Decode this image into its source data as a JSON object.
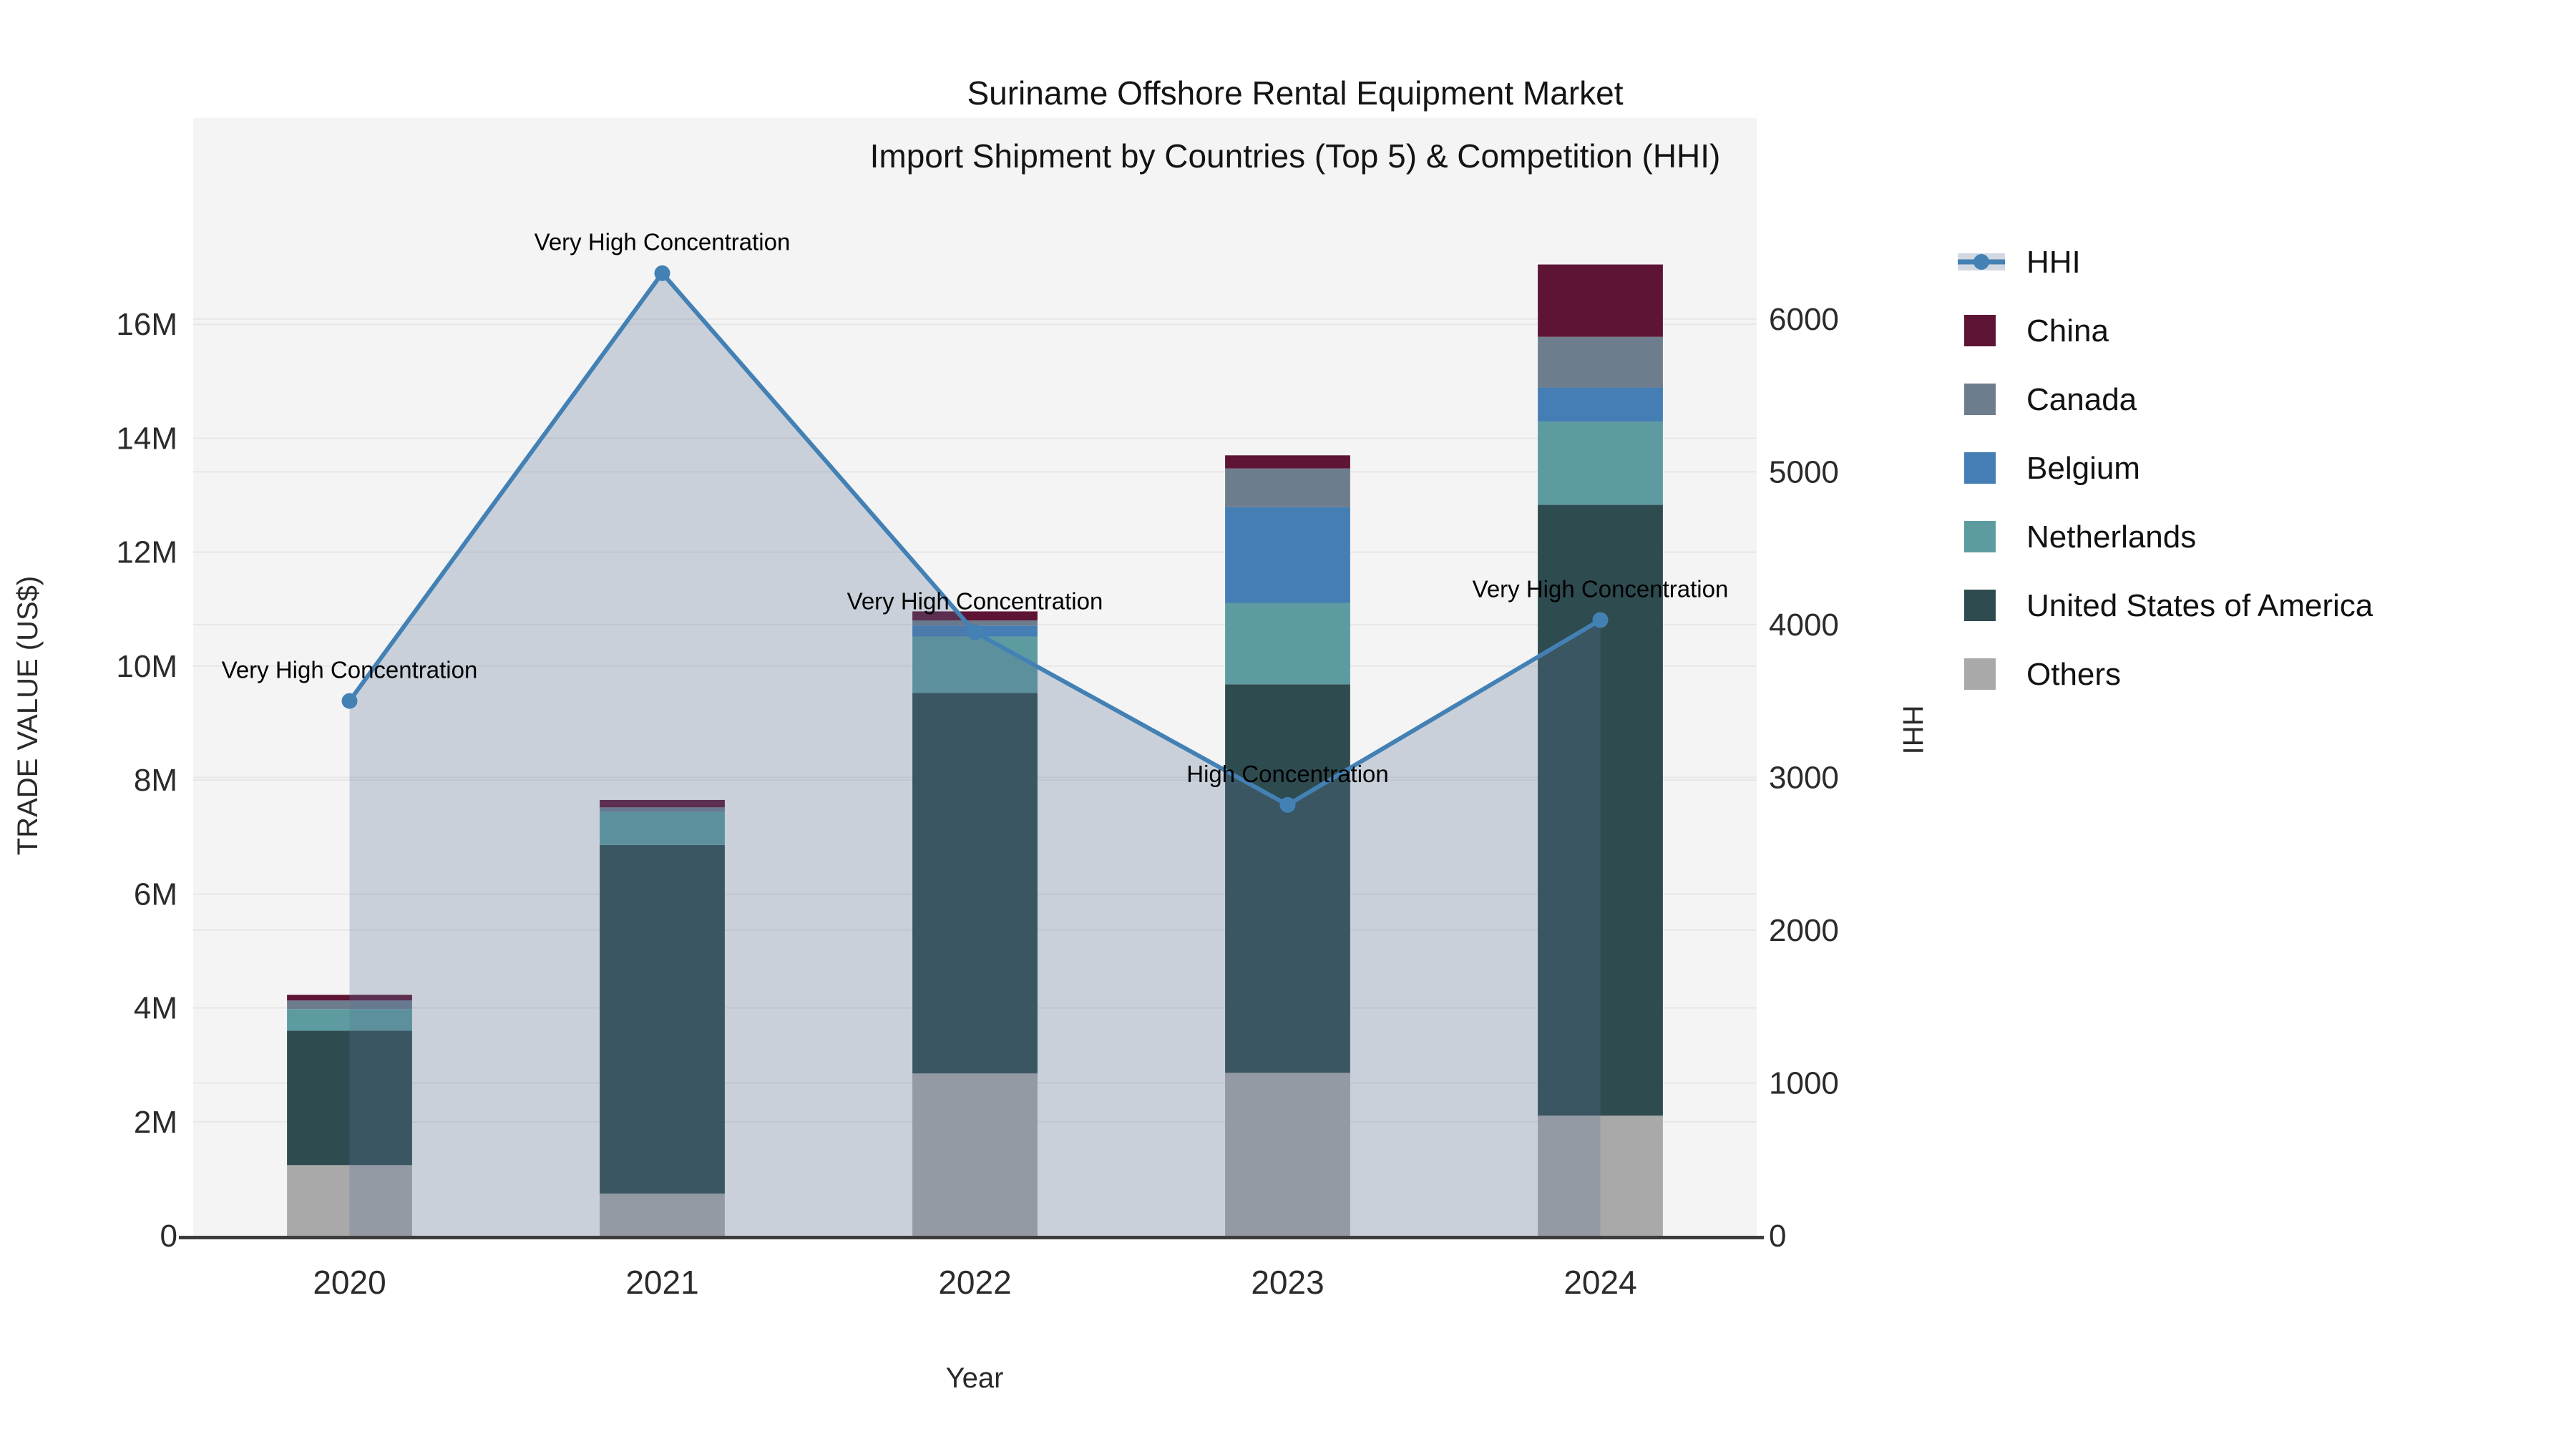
{
  "chart_data": {
    "type": "bar+line",
    "title": "Suriname Offshore Rental Equipment Market",
    "subtitle": "Import Shipment by Countries (Top 5) & Competition (HHI)",
    "xlabel": "Year",
    "ylabel_left": "TRADE VALUE (US$)",
    "ylabel_right": "HHI",
    "categories": [
      "2020",
      "2021",
      "2022",
      "2023",
      "2024"
    ],
    "bar_unit": "millions of US$",
    "stack_order_bottom_to_top": [
      "Others",
      "United States of America",
      "Netherlands",
      "Belgium",
      "Canada",
      "China"
    ],
    "series": [
      {
        "name": "China",
        "color": "#5e1535",
        "values": [
          0.1,
          0.13,
          0.16,
          0.23,
          1.27
        ]
      },
      {
        "name": "Canada",
        "color": "#6e7d8e",
        "values": [
          0.15,
          0.08,
          0.09,
          0.68,
          0.89
        ]
      },
      {
        "name": "Belgium",
        "color": "#447eb4",
        "values": [
          0.0,
          0.0,
          0.19,
          1.68,
          0.6
        ]
      },
      {
        "name": "Netherlands",
        "color": "#5d9ba0",
        "values": [
          0.38,
          0.58,
          0.99,
          1.43,
          1.46
        ]
      },
      {
        "name": "United States of America",
        "color": "#2e4b50",
        "values": [
          2.36,
          6.12,
          6.68,
          6.82,
          10.72
        ]
      },
      {
        "name": "Others",
        "color": "#a9a9a9",
        "values": [
          1.24,
          0.74,
          2.85,
          2.86,
          2.11
        ]
      }
    ],
    "bar_totals": [
      4.23,
      7.65,
      10.96,
      13.7,
      17.05
    ],
    "line_series": {
      "name": "HHI",
      "axis": "right",
      "color": "#4381b5",
      "fill_color": "rgba(88,114,150,0.28)",
      "values": [
        3500,
        6300,
        3950,
        2820,
        4030
      ],
      "annotations": [
        "Very High Concentration",
        "Very High Concentration",
        "Very High Concentration",
        "High Concentration",
        "Very High Concentration"
      ]
    },
    "y_left": {
      "tick_values": [
        0,
        2,
        4,
        6,
        8,
        10,
        12,
        14,
        16
      ],
      "tick_labels": [
        "0",
        "2M",
        "4M",
        "6M",
        "8M",
        "10M",
        "12M",
        "14M",
        "16M"
      ],
      "max": 19.62
    },
    "y_right": {
      "tick_values": [
        0,
        1000,
        2000,
        3000,
        4000,
        5000,
        6000
      ],
      "tick_labels": [
        "0",
        "1000",
        "2000",
        "3000",
        "4000",
        "5000",
        "6000"
      ],
      "max": 7315
    },
    "grid": true,
    "legend_position": "right",
    "legend_items": [
      {
        "label": "HHI",
        "type": "line",
        "color": "#4381b5"
      },
      {
        "label": "China",
        "type": "square",
        "color": "#5e1535"
      },
      {
        "label": "Canada",
        "type": "square",
        "color": "#6e7d8e"
      },
      {
        "label": "Belgium",
        "type": "square",
        "color": "#447eb4"
      },
      {
        "label": "Netherlands",
        "type": "square",
        "color": "#5d9ba0"
      },
      {
        "label": "United States of America",
        "type": "square",
        "color": "#2e4b50"
      },
      {
        "label": "Others",
        "type": "square",
        "color": "#a9a9a9"
      }
    ]
  },
  "colors": {
    "plot_background": "#f4f4f4",
    "gridline": "#e7e7e7",
    "axis_line": "#3d3d3d",
    "hhi_line": "#4381b5",
    "hhi_fill": "rgba(88,114,150,0.28)"
  }
}
